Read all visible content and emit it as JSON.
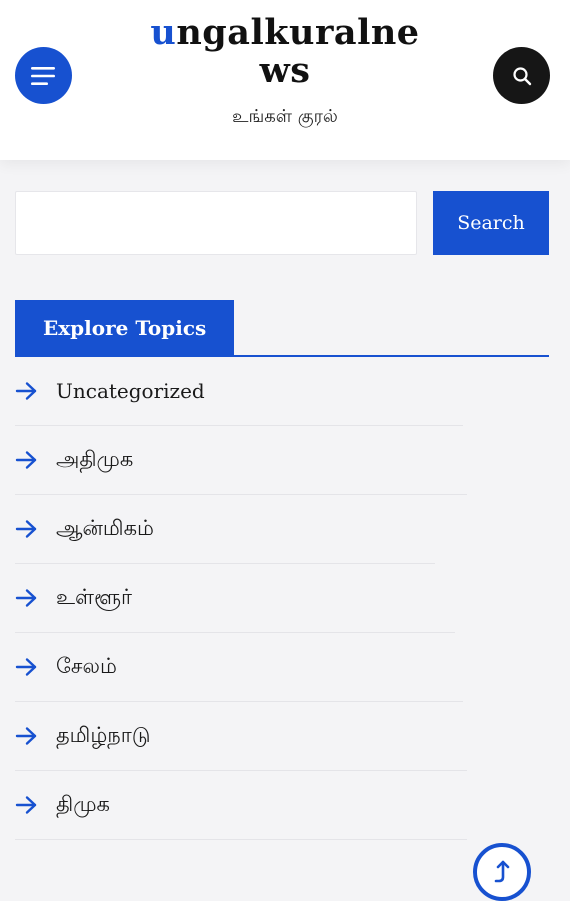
{
  "header": {
    "site_title_first": "u",
    "site_title_rest": "ngalkuralnews",
    "tagline": "உங்கள் குரல்",
    "menu_icon": "hamburger-icon",
    "search_icon": "search-icon"
  },
  "search": {
    "value": "",
    "placeholder": "",
    "button_label": "Search"
  },
  "topics": {
    "title": "Explore Topics",
    "items": [
      {
        "label": "Uncategorized"
      },
      {
        "label": "அதிமுக"
      },
      {
        "label": "ஆன்மிகம்"
      },
      {
        "label": "உள்ளூர்"
      },
      {
        "label": "சேலம்"
      },
      {
        "label": "தமிழ்நாடு"
      },
      {
        "label": "திமுக"
      }
    ]
  },
  "scroll_top_icon": "arrow-up-icon",
  "colors": {
    "accent": "#1751d0",
    "dark": "#161616",
    "background": "#f4f4f6"
  }
}
